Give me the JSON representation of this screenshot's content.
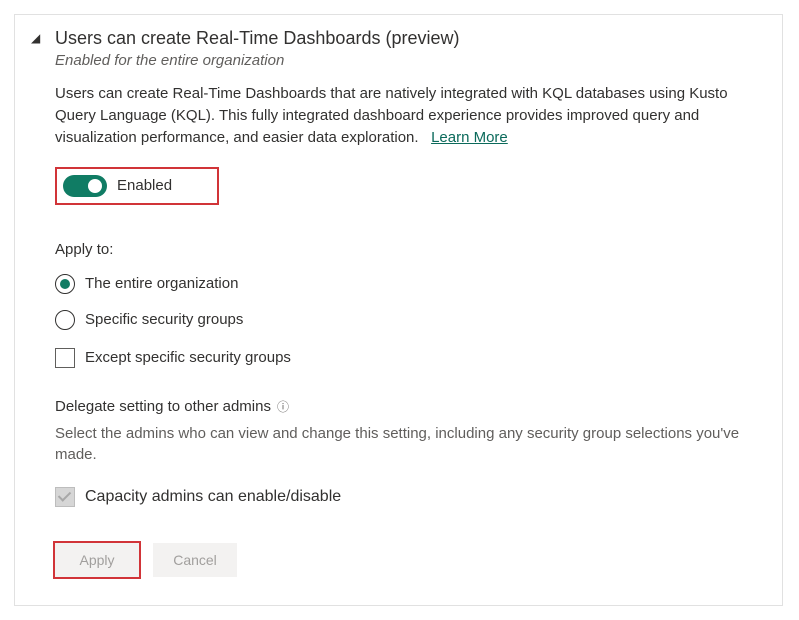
{
  "header": {
    "title": "Users can create Real-Time Dashboards (preview)",
    "subtitle": "Enabled for the entire organization"
  },
  "description": "Users can create Real-Time Dashboards that are natively integrated with KQL databases using Kusto Query Language (KQL). This fully integrated dashboard experience provides improved query and visualization performance, and easier data exploration.",
  "learn_more_label": "Learn More",
  "toggle_state_label": "Enabled",
  "apply_to": {
    "label": "Apply to:",
    "option_entire_org": "The entire organization",
    "option_specific_groups": "Specific security groups",
    "option_except_groups": "Except specific security groups"
  },
  "delegate": {
    "label": "Delegate setting to other admins",
    "description": "Select the admins who can view and change this setting, including any security group selections you've made.",
    "option_capacity_admins": "Capacity admins can enable/disable"
  },
  "buttons": {
    "apply": "Apply",
    "cancel": "Cancel"
  }
}
